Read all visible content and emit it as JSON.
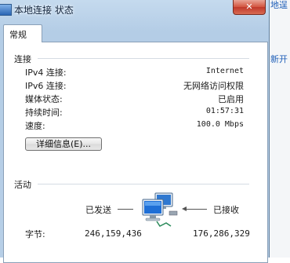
{
  "window": {
    "title": "本地连接 状态",
    "close_symbol": "✕"
  },
  "tabs": [
    "常规"
  ],
  "connection": {
    "heading": "连接",
    "rows": [
      {
        "label": "IPv4 连接:",
        "value": "Internet"
      },
      {
        "label": "IPv6 连接:",
        "value": "无网络访问权限"
      },
      {
        "label": "媒体状态:",
        "value": "已启用"
      },
      {
        "label": "持续时间:",
        "value": "01:57:31"
      },
      {
        "label": "速度:",
        "value": "100.0 Mbps"
      }
    ],
    "details_button": "详细信息(E)..."
  },
  "activity": {
    "heading": "活动",
    "sent_label": "已发送",
    "received_label": "已接收",
    "bytes_label": "字节:",
    "sent_bytes": "246,159,436",
    "received_bytes": "176,286,329",
    "icon": "network-computers-icon"
  },
  "background": {
    "link_1": "地逞",
    "link_2": "新开"
  },
  "colors": {
    "title_bar": "#bcd3ea",
    "close_button": "#c9483a",
    "link": "#1f5fb8"
  }
}
